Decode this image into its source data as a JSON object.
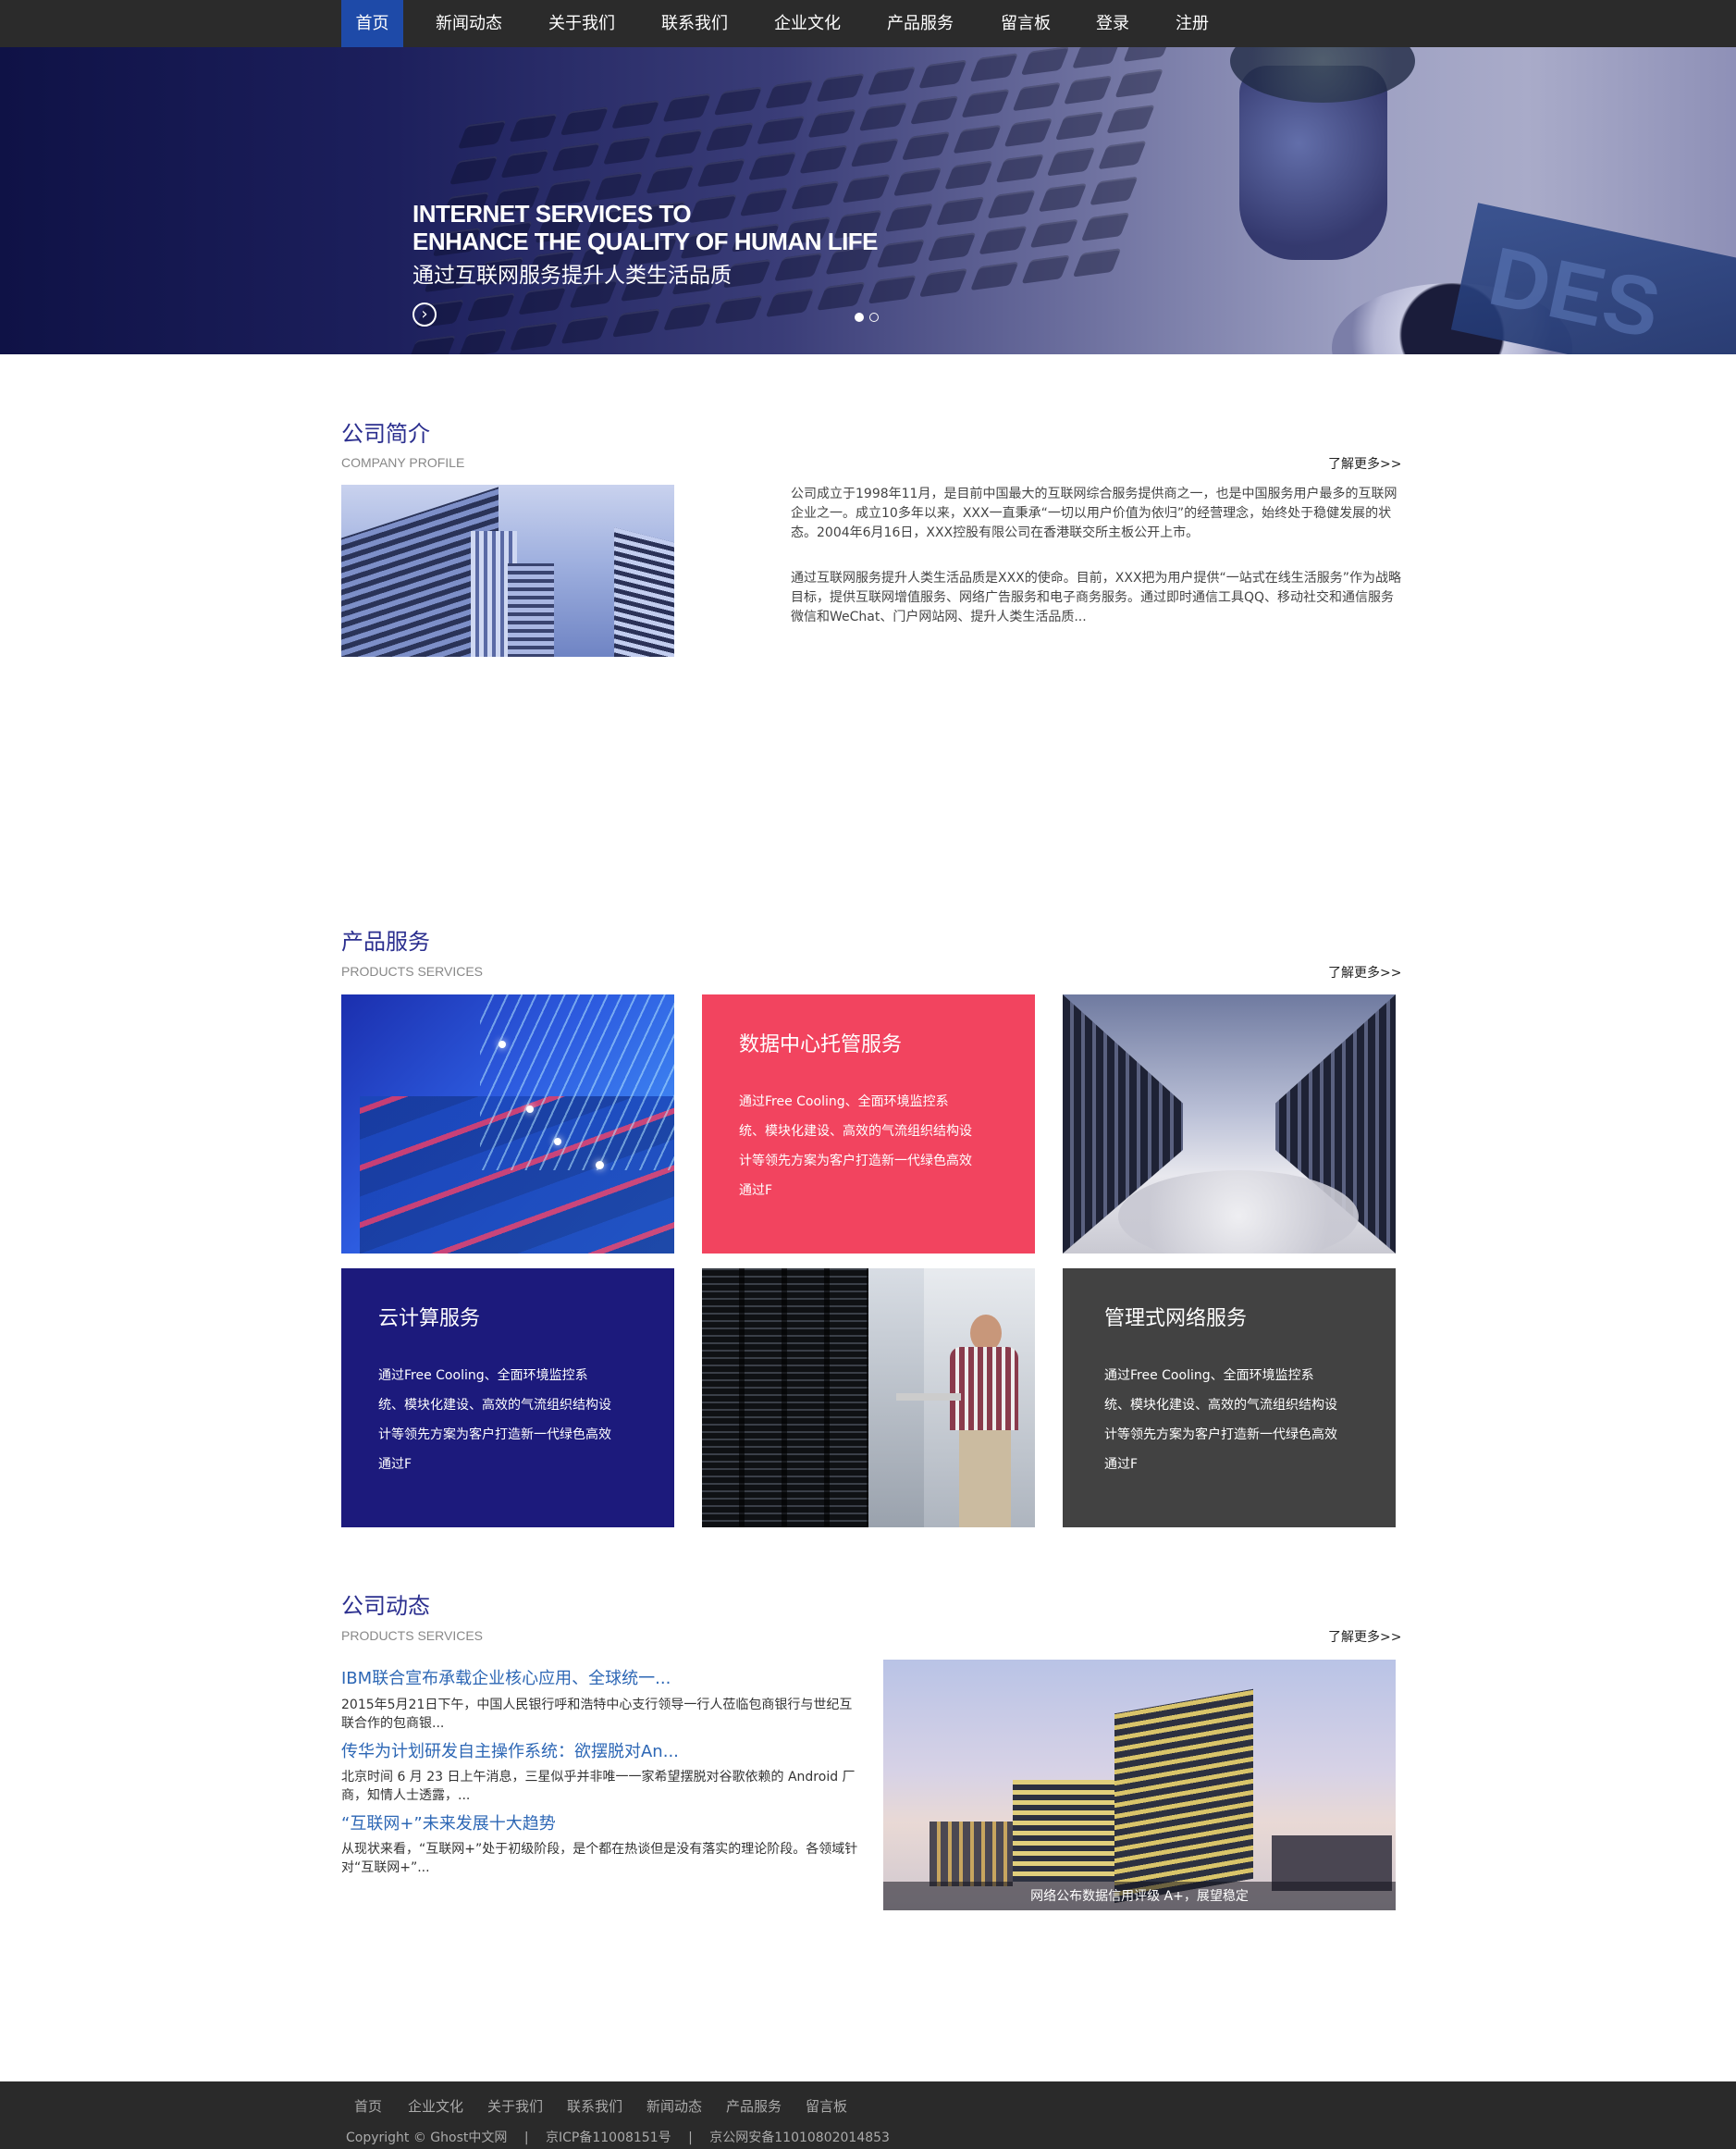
{
  "nav": {
    "items": [
      {
        "label": "首页",
        "active": true
      },
      {
        "label": "新闻动态"
      },
      {
        "label": "关于我们"
      },
      {
        "label": "联系我们"
      },
      {
        "label": "企业文化"
      },
      {
        "label": "产品服务"
      },
      {
        "label": "留言板"
      },
      {
        "label": "登录"
      },
      {
        "label": "注册"
      }
    ]
  },
  "banner": {
    "title_line1": "INTERNET SERVICES TO",
    "title_line2": "ENHANCE THE QUALITY OF HUMAN LIFE",
    "subtitle": "通过互联网服务提升人类生活品质",
    "arrow_icon": "chevron-right-circle-icon",
    "slide_count": 2,
    "active_slide": 1,
    "bg_text": "DES"
  },
  "profile": {
    "title": "公司简介",
    "subtitle": "COMPANY PROFILE",
    "more": "了解更多>>",
    "para1_line1": "公司成立于1998年11月，是目前中国最大的互联网综合服务提供商之一，也是中国服务用户最多的互联网",
    "para1_line2": "企业之一。成立10多年以来，XXX一直秉承“一切以用户价值为依归”的经营理念，始终处于稳健发展的状",
    "para1_line3": "态。2004年6月16日，XXX控股有限公司在香港联交所主板公开上市。",
    "para2_line1": "通过互联网服务提升人类生活品质是XXX的使命。目前，XXX把为用户提供“一站式在线生活服务”作为战略",
    "para2_line2": "目标，提供互联网增值服务、网络广告服务和电子商务服务。通过即时通信工具QQ、移动社交和通信服务",
    "para2_line3": "微信和WeChat、门户网站网、提升人类生活品质..."
  },
  "products": {
    "title": "产品服务",
    "subtitle": "PRODUCTS SERVICES",
    "more": "了解更多>>",
    "tiles": [
      {
        "title": "数据中心托管服务",
        "lines": [
          "通过Free Cooling、全面环境监控系",
          "统、模块化建设、高效的气流组织结构设",
          "计等领先方案为客户打造新一代绿色高效",
          "通过F"
        ],
        "color": "#f2445f"
      },
      {
        "title": "云计算服务",
        "lines": [
          "通过Free Cooling、全面环境监控系",
          "统、模块化建设、高效的气流组织结构设",
          "计等领先方案为客户打造新一代绿色高效",
          "通过F"
        ],
        "color": "#1c1a7c"
      },
      {
        "title": "管理式网络服务",
        "lines": [
          "通过Free Cooling、全面环境监控系",
          "统、模块化建设、高效的气流组织结构设",
          "计等领先方案为客户打造新一代绿色高效",
          "通过F"
        ],
        "color": "#424242"
      }
    ]
  },
  "news": {
    "title": "公司动态",
    "subtitle": "PRODUCTS SERVICES",
    "more": "了解更多>>",
    "items": [
      {
        "headline": "IBM联合宣布承载企业核心应用、全球统一...",
        "line1": "2015年5月21日下午，中国人民银行呼和浩特中心支行领导一行人莅临包商银行与世纪互",
        "line2": "联合作的包商银..."
      },
      {
        "headline": "传华为计划研发自主操作系统：欲摆脱对An...",
        "line1": "北京时间 6 月 23 日上午消息，三星似乎并非唯一一家希望摆脱对谷歌依赖的 Android 厂",
        "line2": "商，知情人士透露，..."
      },
      {
        "headline": "“互联网+”未来发展十大趋势",
        "line1": "从现状来看，“互联网+”处于初级阶段，是个都在热谈但是没有落实的理论阶段。各领域针",
        "line2": "对“互联网+”..."
      }
    ],
    "image_caption": "网络公布数据信用评级 A+，展望稳定"
  },
  "footer": {
    "links": [
      "首页",
      "企业文化",
      "关于我们",
      "联系我们",
      "新闻动态",
      "产品服务",
      "留言板"
    ],
    "copyright": "Copyright © Ghost中文网",
    "icp": "京ICP备11008151号",
    "police": "京公网安备11010802014853",
    "separator": "|"
  },
  "colors": {
    "nav_bg": "#2b2b2b",
    "nav_active": "#1e4aa8",
    "heading": "#2b2f8f",
    "news_link": "#2d67b5",
    "tile_pink": "#f2445f",
    "tile_navy": "#1c1a7c",
    "tile_gray": "#424242",
    "footer_bg": "#2a2a2a"
  }
}
